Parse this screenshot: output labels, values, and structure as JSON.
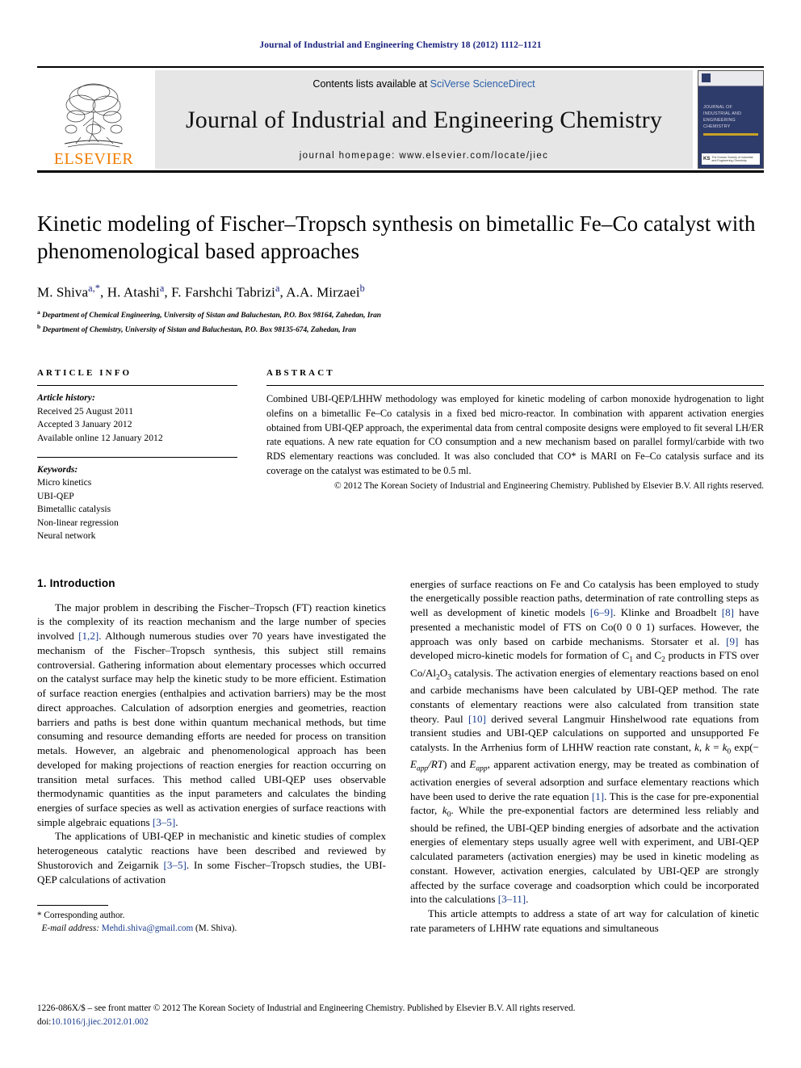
{
  "running_head": "Journal of Industrial and Engineering Chemistry 18 (2012) 1112–1121",
  "masthead": {
    "publisher_name": "ELSEVIER",
    "contents_prefix": "Contents lists available at ",
    "contents_link": "SciVerse ScienceDirect",
    "journal_title": "Journal of Industrial and Engineering Chemistry",
    "homepage": "journal homepage: www.elsevier.com/locate/jiec",
    "cover": {
      "title_lines": "JOURNAL OF INDUSTRIAL AND ENGINEERING CHEMISTRY",
      "society_text": "The Korean Society of Industrial and Engineering Chemistry",
      "society_mark": "KS"
    }
  },
  "article": {
    "title": "Kinetic modeling of Fischer–Tropsch synthesis on bimetallic Fe–Co catalyst with phenomenological based approaches",
    "authors_html": "M. Shiva <sup>a,*</sup>, H. Atashi <sup>a</sup>, F. Farshchi Tabrizi <sup>a</sup>, A.A. Mirzaei <sup>b</sup>",
    "affiliation_a": "Department of Chemical Engineering, University of Sistan and Baluchestan, P.O. Box 98164, Zahedan, Iran",
    "affiliation_b": "Department of Chemistry, University of Sistan and Baluchestan, P.O. Box 98135-674, Zahedan, Iran"
  },
  "article_info": {
    "heading": "ARTICLE INFO",
    "history_label": "Article history:",
    "received": "Received 25 August 2011",
    "accepted": "Accepted 3 January 2012",
    "available_online": "Available online 12 January 2012",
    "keywords_label": "Keywords:",
    "keywords": [
      "Micro kinetics",
      "UBI-QEP",
      "Bimetallic catalysis",
      "Non-linear regression",
      "Neural network"
    ]
  },
  "abstract": {
    "heading": "ABSTRACT",
    "text": "Combined UBI-QEP/LHHW methodology was employed for kinetic modeling of carbon monoxide hydrogenation to light olefins on a bimetallic Fe–Co catalysis in a fixed bed micro-reactor. In combination with apparent activation energies obtained from UBI-QEP approach, the experimental data from central composite designs were employed to fit several LH/ER rate equations. A new rate equation for CO consumption and a new mechanism based on parallel formyl/carbide with two RDS elementary reactions was concluded. It was also concluded that CO* is MARI on Fe–Co catalysis surface and its coverage on the catalyst was estimated to be 0.5 ml.",
    "copyright": "© 2012 The Korean Society of Industrial and Engineering Chemistry. Published by Elsevier B.V. All rights reserved."
  },
  "introduction": {
    "section_title": "1. Introduction",
    "left_paragraph_1": "The major problem in describing the Fischer–Tropsch (FT) reaction kinetics is the complexity of its reaction mechanism and the large number of species involved [1,2]. Although numerous studies over 70 years have investigated the mechanism of the Fischer–Tropsch synthesis, this subject still remains controversial. Gathering information about elementary processes which occurred on the catalyst surface may help the kinetic study to be more efficient. Estimation of surface reaction energies (enthalpies and activation barriers) may be the most direct approaches. Calculation of adsorption energies and geometries, reaction barriers and paths is best done within quantum mechanical methods, but time consuming and resource demanding efforts are needed for process on transition metals. However, an algebraic and phenomenological approach has been developed for making projections of reaction energies for reaction occurring on transition metal surfaces. This method called UBI-QEP uses observable thermodynamic quantities as the input parameters and calculates the binding energies of surface species as well as activation energies of surface reactions with simple algebraic equations [3–5].",
    "left_paragraph_2": "The applications of UBI-QEP in mechanistic and kinetic studies of complex heterogeneous catalytic reactions have been described and reviewed by Shustorovich and Zeigarnik [3–5]. In some Fischer–Tropsch studies, the UBI-QEP calculations of activation",
    "right_paragraph_1": "energies of surface reactions on Fe and Co catalysis has been employed to study the energetically possible reaction paths, determination of rate controlling steps as well as development of kinetic models [6–9]. Klinke and Broadbelt [8] have presented a mechanistic model of FTS on Co(0 0 0 1) surfaces. However, the approach was only based on carbide mechanisms. Storsater et al. [9] has developed micro-kinetic models for formation of C1 and C2 products in FTS over Co/Al2O3 catalysis. The activation energies of elementary reactions based on enol and carbide mechanisms have been calculated by UBI-QEP method. The rate constants of elementary reactions were also calculated from transition state theory. Paul [10] derived several Langmuir Hinshelwood rate equations from transient studies and UBI-QEP calculations on supported and unsupported Fe catalysts. In the Arrhenius form of LHHW reaction rate constant, k, k = k0 exp(− Eapp/RT) and Eapp, apparent activation energy, may be treated as combination of activation energies of several adsorption and surface elementary reactions which have been used to derive the rate equation [1]. This is the case for pre-exponential factor, k0. While the pre-exponential factors are determined less reliably and should be refined, the UBI-QEP binding energies of adsorbate and the activation energies of elementary steps usually agree well with experiment, and UBI-QEP calculated parameters (activation energies) may be used in kinetic modeling as constant. However, activation energies, calculated by UBI-QEP are strongly affected by the surface coverage and coadsorption which could be incorporated into the calculations [3–11].",
    "right_paragraph_2": "This article attempts to address a state of art way for calculation of kinetic rate parameters of LHHW rate equations and simultaneous"
  },
  "footnote": {
    "corresponding": "* Corresponding author.",
    "email_label": "E-mail address:",
    "email": "Mehdi.shiva@gmail.com",
    "email_suffix": "(M. Shiva)."
  },
  "page_footer": {
    "front_matter": "1226-086X/$ – see front matter © 2012 The Korean Society of Industrial and Engineering Chemistry. Published by Elsevier B.V. All rights reserved.",
    "doi_prefix": "doi:",
    "doi": "10.1016/j.jiec.2012.01.002"
  },
  "colors": {
    "link_blue": "#1a3c8c",
    "elsevier_orange": "#F07D00",
    "header_navy": "#1a237e"
  }
}
